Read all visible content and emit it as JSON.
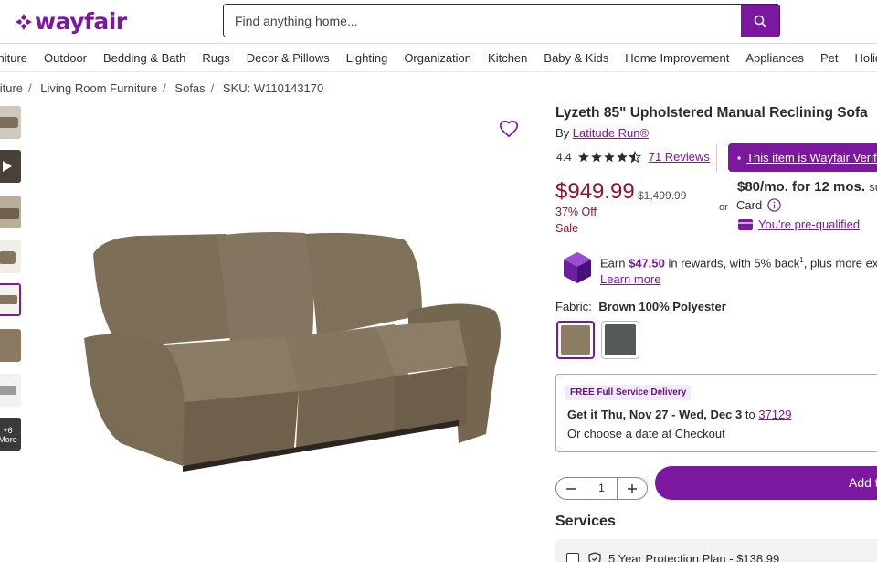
{
  "header": {
    "logo_text": "wayfair",
    "search_placeholder": "Find anything home..."
  },
  "nav": {
    "items": [
      "Furniture",
      "Outdoor",
      "Bedding & Bath",
      "Rugs",
      "Decor & Pillows",
      "Lighting",
      "Organization",
      "Kitchen",
      "Baby & Kids",
      "Home Improvement",
      "Appliances",
      "Pet",
      "Holiday"
    ]
  },
  "breadcrumb": {
    "items": [
      "Furniture",
      "Living Room Furniture",
      "Sofas"
    ],
    "sku": "SKU: W110143170"
  },
  "gallery": {
    "more_label": "+6 More"
  },
  "product": {
    "title": "Lyzeth 85\" Upholstered Manual Reclining Sofa",
    "by": "By",
    "brand": "Latitude Run®",
    "rating": "4.4",
    "rating_value": 4.4,
    "reviews": "71 Reviews",
    "verified": "This item is Wayfair Verified",
    "price": "$949.99",
    "was_price": "$1,499.99",
    "discount": "37% Off",
    "sale": "Sale"
  },
  "financing": {
    "or": "or",
    "monthly": "$80/mo. for 12 mos.",
    "suffix": "sub",
    "card": "Card",
    "prequalified": "You're pre-qualified"
  },
  "rewards": {
    "earn": "Earn",
    "amount": "$47.50",
    "text": "in rewards, with 5% back",
    "sup": "1",
    "text2": ", plus more exclusive",
    "learn_more": "Learn more"
  },
  "fabric": {
    "label": "Fabric:",
    "value": "Brown 100% Polyester",
    "colors": {
      "brown": "#8c7c64",
      "gray": "#555a58"
    }
  },
  "delivery": {
    "badge": "FREE Full Service Delivery",
    "get_it": "Get it",
    "dates": "Thu, Nov 27 - Wed, Dec 3",
    "to": "to",
    "zip": "37129",
    "alt": "Or choose a date at Checkout"
  },
  "cart": {
    "quantity": "1",
    "add_label": "Add to Cart"
  },
  "services": {
    "title": "Services",
    "plan": "5 Year Protection Plan - $138.99"
  },
  "colors": {
    "brand": "#7b189f",
    "price": "#8b1538"
  }
}
